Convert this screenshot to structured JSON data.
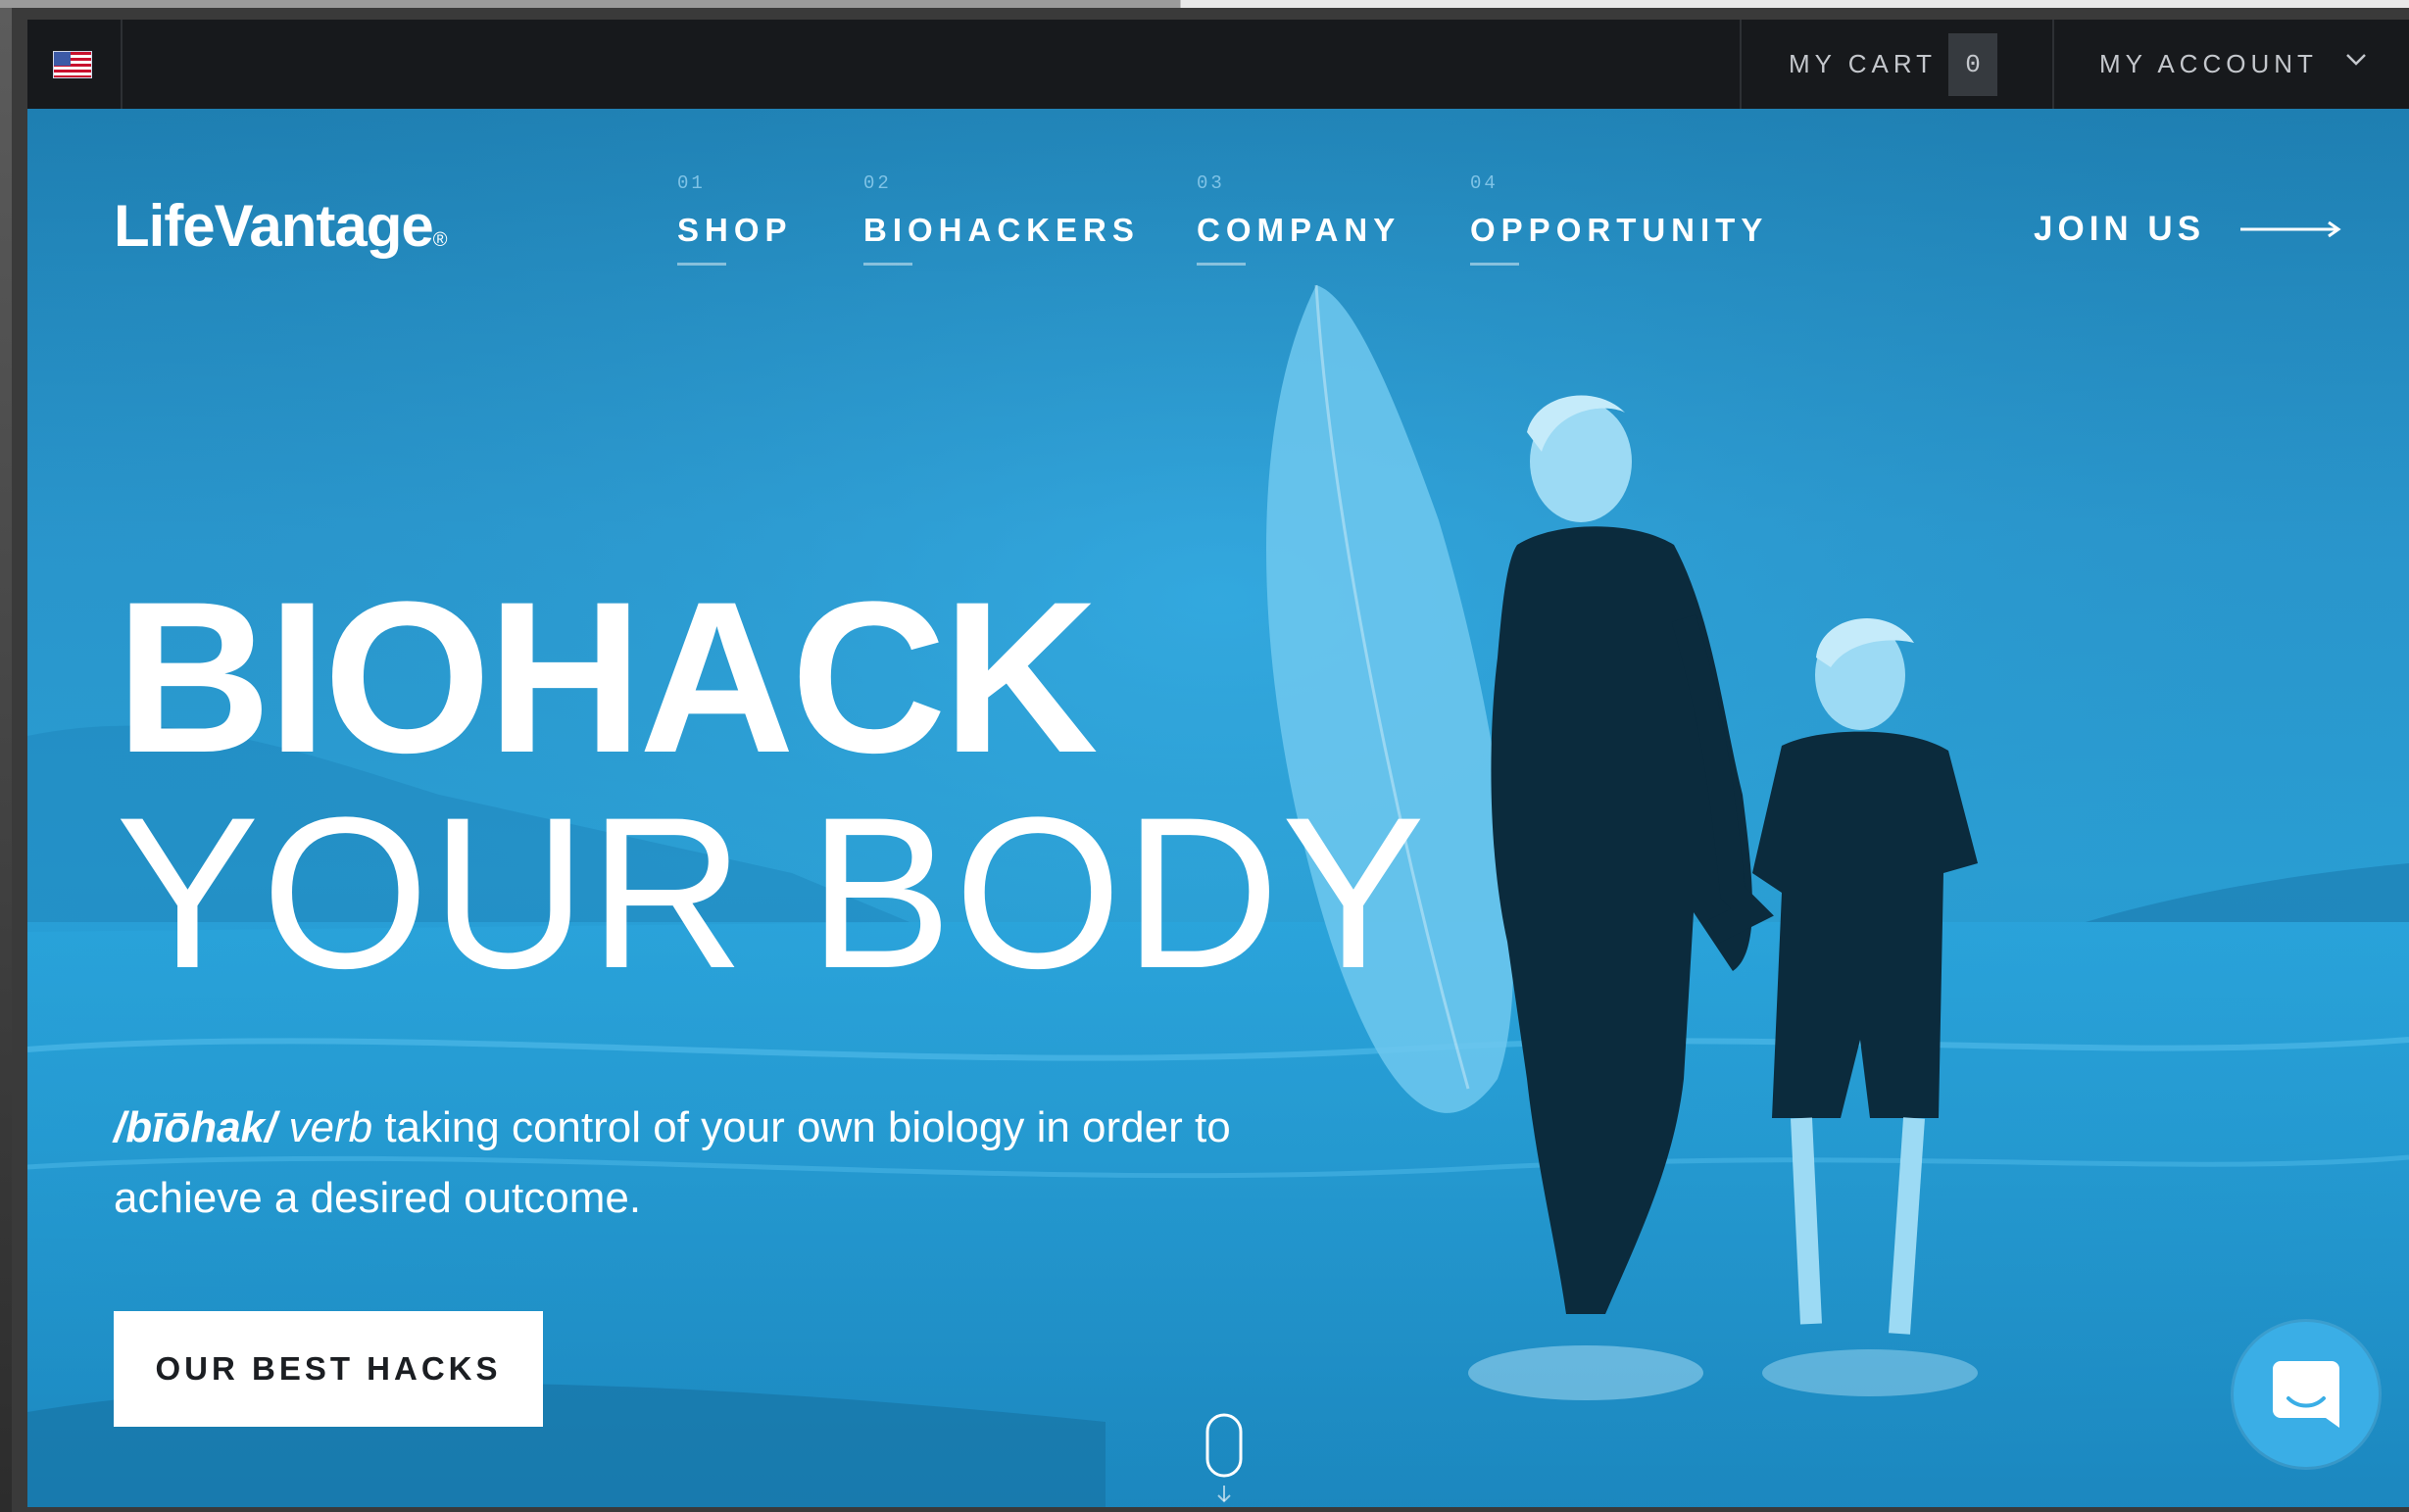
{
  "topbar": {
    "flag": "us-flag-icon",
    "cart_label": "MY CART",
    "cart_count": "0",
    "account_label": "MY ACCOUNT"
  },
  "brand": {
    "name": "LifeVantage",
    "reg": "®"
  },
  "nav": [
    {
      "num": "01",
      "label": "SHOP"
    },
    {
      "num": "02",
      "label": "BIOHACKERS"
    },
    {
      "num": "03",
      "label": "COMPANY"
    },
    {
      "num": "04",
      "label": "OPPORTUNITY"
    }
  ],
  "join": {
    "label": "JOIN US"
  },
  "hero": {
    "line1": "BIOHACK",
    "line2": "YOUR BODY",
    "phonetic": "/bīōhak/",
    "part_of_speech": "verb",
    "definition": "taking control of your own biology in order to achieve a desired outcome.",
    "cta": "OUR BEST HACKS"
  },
  "colors": {
    "topbar": "#17191c",
    "hero_blue": "#2aa2d8",
    "text": "#ffffff"
  }
}
